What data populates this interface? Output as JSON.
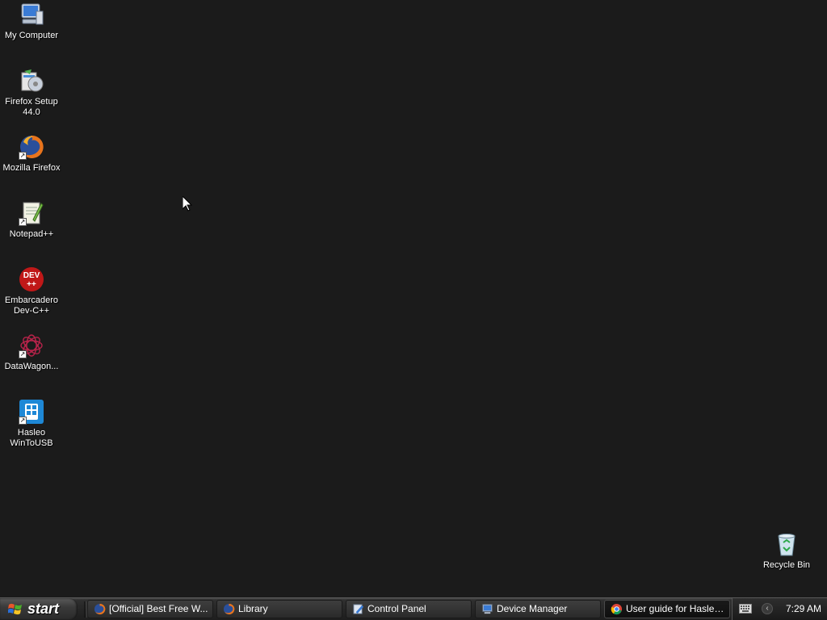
{
  "desktop": {
    "background_color": "#1b1b1b",
    "icons": [
      {
        "label": "My Computer",
        "icon": "my-computer-icon"
      },
      {
        "label": "Firefox Setup 44.0",
        "icon": "installer-icon"
      },
      {
        "label": "Mozilla Firefox",
        "icon": "firefox-icon"
      },
      {
        "label": "Notepad++",
        "icon": "notepad-plus-plus-icon"
      },
      {
        "label": "Embarcadero Dev-C++",
        "icon": "dev-cpp-icon"
      },
      {
        "label": "DataWagon...",
        "icon": "datawagon-icon"
      },
      {
        "label": "Hasleo WinToUSB",
        "icon": "wintousb-icon"
      }
    ],
    "recycle_bin": {
      "label": "Recycle Bin",
      "icon": "recycle-bin-icon"
    },
    "dev_icon_text": "DEV",
    "dev_icon_plus": "++"
  },
  "taskbar": {
    "start_label": "start",
    "tasks": [
      {
        "label": "[Official] Best Free W...",
        "icon": "firefox-icon",
        "active": false
      },
      {
        "label": "Library",
        "icon": "firefox-icon",
        "active": false
      },
      {
        "label": "Control Panel",
        "icon": "control-panel-icon",
        "active": false
      },
      {
        "label": "Device Manager",
        "icon": "device-manager-icon",
        "active": false
      },
      {
        "label": "User guide for Hasleo...",
        "icon": "chrome-icon",
        "active": true
      }
    ],
    "tray": {
      "clock": "7:29 AM",
      "chevron": "‹"
    }
  }
}
